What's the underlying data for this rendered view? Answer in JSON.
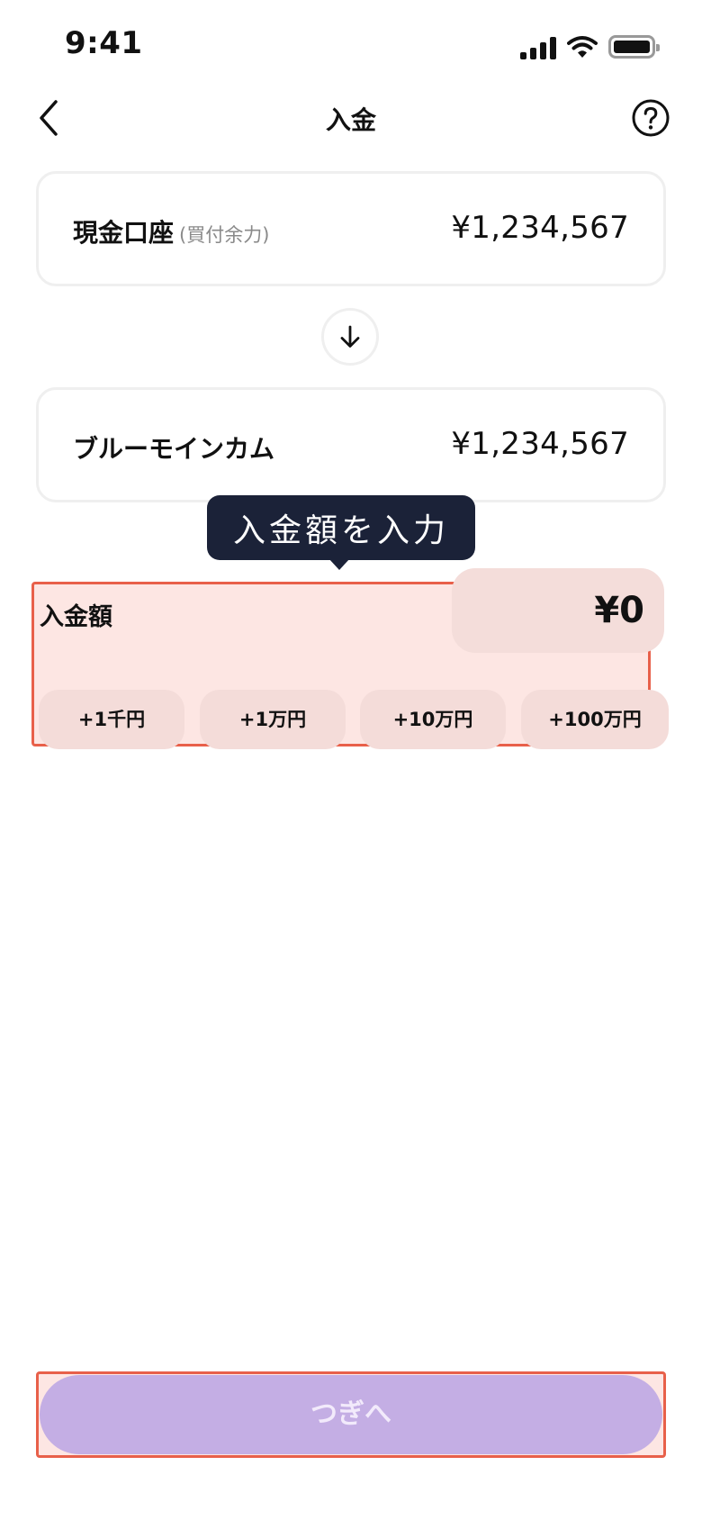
{
  "status_bar": {
    "time": "9:41"
  },
  "nav": {
    "title": "入金"
  },
  "source_account": {
    "name": "現金口座",
    "sub_label": "(買付余力)",
    "balance": "¥1,234,567"
  },
  "dest_account": {
    "name": "ブルーモインカム",
    "balance": "¥1,234,567"
  },
  "tooltip": {
    "text": "入金額を入力"
  },
  "amount": {
    "label": "入金額",
    "value": "¥0",
    "quick_adds": [
      "+1千円",
      "+1万円",
      "+10万円",
      "+100万円"
    ]
  },
  "next_button": {
    "label": "つぎへ"
  },
  "colors": {
    "tooltip_bg": "#1b2238",
    "highlight_fill": "#fde6e3",
    "highlight_border": "#e8604a",
    "next_button_disabled": "#c4aee4"
  },
  "icons": {
    "back": "chevron-left-icon",
    "help": "question-circle-icon",
    "transfer": "arrow-down-icon"
  }
}
